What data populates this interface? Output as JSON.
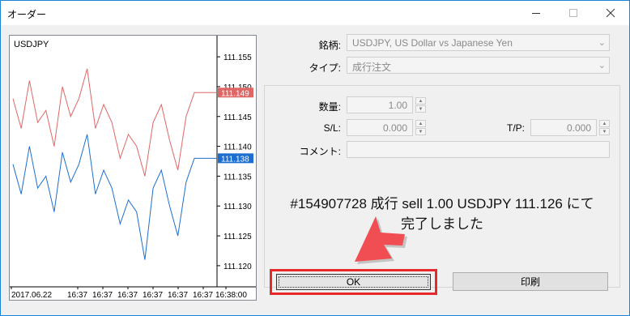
{
  "window": {
    "title": "オーダー",
    "min_icon": "minimize-icon",
    "max_icon": "maximize-icon",
    "close_icon": "close-icon"
  },
  "chart": {
    "symbol": "USDJPY",
    "y_ticks": [
      "111.155",
      "111.150",
      "111.145",
      "111.140",
      "111.135",
      "111.130",
      "111.125",
      "111.120"
    ],
    "x_ticks": [
      "2017.06.22",
      "16:37",
      "16:37",
      "16:37",
      "16:37",
      "16:37",
      "16:37",
      "16:38:00"
    ],
    "ask_label": "111.149",
    "bid_label": "111.138",
    "ask_color": "#e06666",
    "bid_color": "#1c6fd1"
  },
  "chart_data": {
    "type": "line",
    "title": "USDJPY",
    "xlabel": "",
    "ylabel": "",
    "ylim": [
      111.117,
      111.158
    ],
    "x": [
      "2017.06.22",
      "16:37",
      "16:37",
      "16:37",
      "16:37",
      "16:37",
      "16:37",
      "16:38:00"
    ],
    "series": [
      {
        "name": "",
        "color": "#e06666",
        "values": [
          111.148,
          111.143,
          111.151,
          111.144,
          111.146,
          111.14,
          111.15,
          111.145,
          111.148,
          111.153,
          111.143,
          111.147,
          111.144,
          111.138,
          111.142,
          111.14,
          111.135,
          111.144,
          111.147,
          111.141,
          111.136,
          111.145,
          111.149,
          111.149,
          111.149
        ]
      },
      {
        "name": "",
        "color": "#1c6fd1",
        "values": [
          111.137,
          111.132,
          111.14,
          111.133,
          111.135,
          111.129,
          111.139,
          111.134,
          111.137,
          111.142,
          111.132,
          111.136,
          111.133,
          111.127,
          111.131,
          111.129,
          111.121,
          111.133,
          111.136,
          111.13,
          111.125,
          111.134,
          111.138,
          111.138,
          111.138
        ]
      }
    ]
  },
  "form": {
    "symbol_label": "銘柄:",
    "symbol_value": "USDJPY, US Dollar vs Japanese Yen",
    "type_label": "タイプ:",
    "type_value": "成行注文",
    "volume_label": "数量:",
    "volume_value": "1.00",
    "sl_label": "S/L:",
    "sl_value": "0.000",
    "tp_label": "T/P:",
    "tp_value": "0.000",
    "comment_label": "コメント:",
    "comment_value": ""
  },
  "message": {
    "line1": "#154907728 成行 sell 1.00 USDJPY 111.126 にて",
    "line2": "完了しました"
  },
  "buttons": {
    "ok": "OK",
    "print": "印刷"
  }
}
